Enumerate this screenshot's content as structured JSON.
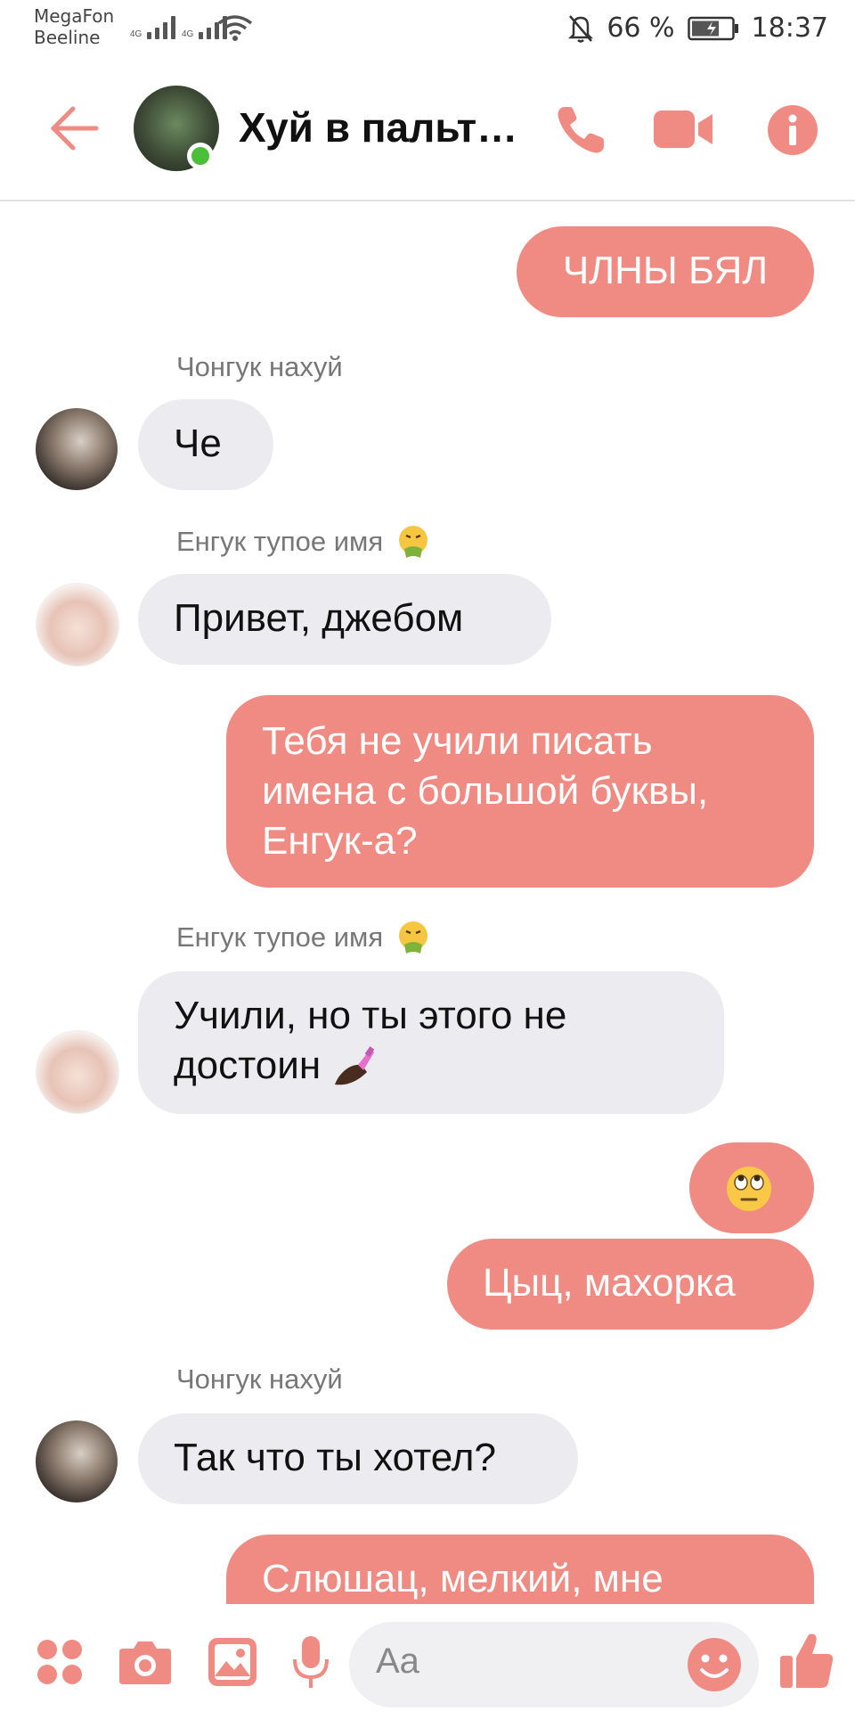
{
  "status": {
    "carrier1": "MegaFon",
    "carrier2": "Beeline",
    "battery": "66 %",
    "time": "18:37"
  },
  "header": {
    "back_icon": "arrow-left-icon",
    "title": "Хуй в пальт…",
    "actions": [
      "phone-icon",
      "video-icon",
      "info-icon"
    ],
    "accent": "#ef8b82"
  },
  "messages": [
    {
      "dir": "out",
      "text": "ЧЛНЫ БЯЛ"
    },
    {
      "dir": "in",
      "sender": "Чонгук нахуй",
      "text": "Че"
    },
    {
      "dir": "in",
      "sender": "Енгук тупое имя",
      "sender_emoji": "nauseated-face",
      "text": "Привет, джебом"
    },
    {
      "dir": "out",
      "lines": [
        "Тебя не учили писать",
        "имена с большой буквы,",
        "Енгук-а?"
      ]
    },
    {
      "dir": "in",
      "sender": "Енгук тупое имя",
      "sender_emoji": "nauseated-face",
      "lines": [
        "Учили, но ты этого не",
        "достоин"
      ],
      "emoji": "nail-polish"
    },
    {
      "dir": "out",
      "emoji": "eye-roll-face"
    },
    {
      "dir": "out",
      "text": "Цыц, махорка"
    },
    {
      "dir": "in",
      "sender": "Чонгук нахуй",
      "text": "Так что ты хотел?"
    },
    {
      "dir": "out",
      "text": "Слюшац, мелкий, мне"
    }
  ],
  "composer": {
    "placeholder": "Aa",
    "icons": [
      "apps-icon",
      "camera-icon",
      "gallery-icon",
      "microphone-icon",
      "emoji-icon",
      "thumbs-up-icon"
    ]
  }
}
